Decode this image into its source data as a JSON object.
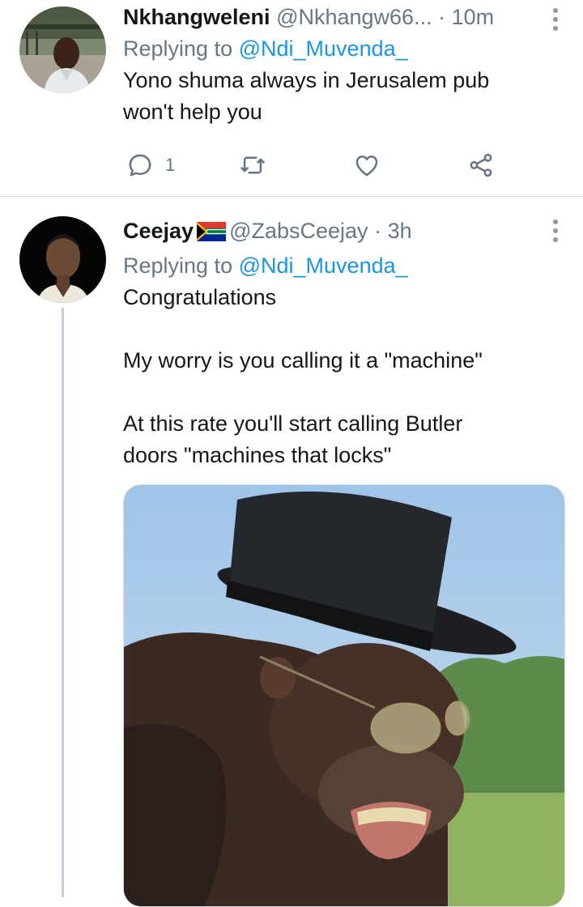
{
  "tweets": [
    {
      "display_name": "Nkhangweleni",
      "handle": "@Nkhangw66...",
      "time_sep": "·",
      "time": "10m",
      "replying_prefix": "Replying to",
      "replying_to": "@Ndi_Muvenda_",
      "text": "Yono shuma always in Jerusalem pub\nwon't help you",
      "reply_count": "1"
    },
    {
      "display_name": "Ceejay",
      "flag": "south-africa-flag",
      "handle": "@ZabsCeejay",
      "time_sep": "·",
      "time": "3h",
      "replying_prefix": "Replying to",
      "replying_to": "@Ndi_Muvenda_",
      "text": "Congratulations\n\nMy worry is you calling it a \"machine\"\n\nAt this rate you'll start calling Butler\ndoors \"machines that locks\""
    }
  ],
  "colors": {
    "link": "#1b95e0",
    "secondary_text": "#657786",
    "primary_text": "#14171a"
  }
}
